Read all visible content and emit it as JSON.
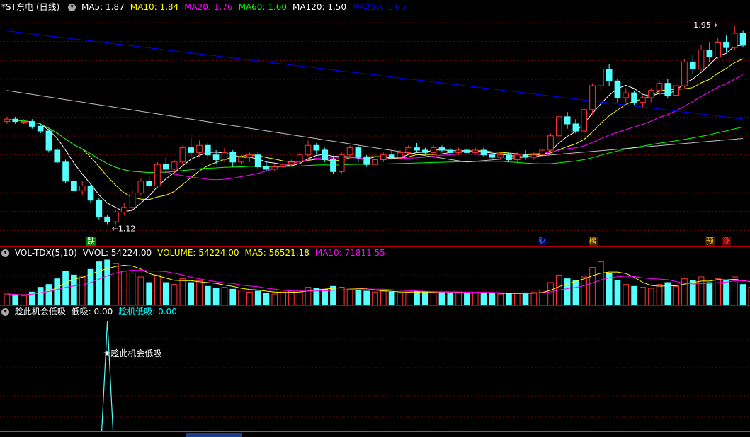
{
  "stock": {
    "name": "*ST东电",
    "period": "(日线)"
  },
  "price_legend": {
    "items": [
      {
        "label": "MA5:",
        "value": "1.87",
        "color": "#ffffff"
      },
      {
        "label": "MA10:",
        "value": "1.84",
        "color": "#ffff00"
      },
      {
        "label": "MA20:",
        "value": "1.76",
        "color": "#ff00ff"
      },
      {
        "label": "MA60:",
        "value": "1.60",
        "color": "#00ff00"
      },
      {
        "label": "MA120:",
        "value": "1.50",
        "color": "#ffffff"
      },
      {
        "label": "MA250:",
        "value": "1.65",
        "color": "#0000ff"
      }
    ]
  },
  "vol_legend": {
    "title": "VOL-TDX(5,10)",
    "items": [
      {
        "label": "VVOL:",
        "value": "54224.00",
        "color": "#ffffff"
      },
      {
        "label": "VOLUME:",
        "value": "54224.00",
        "color": "#ffff00"
      },
      {
        "label": "MA5:",
        "value": "56521.18",
        "color": "#ffff00"
      },
      {
        "label": "MA10:",
        "value": "71811.55",
        "color": "#ff00ff"
      }
    ]
  },
  "ind_legend": {
    "title": "趁此机会低吸",
    "items": [
      {
        "label": "低吸:",
        "value": "0.00",
        "color": "#ffffff"
      },
      {
        "label": "趁机低吸:",
        "value": "0.00",
        "color": "#00ffff"
      }
    ]
  },
  "annotations": {
    "low": "1.12",
    "high": "1.95",
    "signal": "★趁此机会低吸"
  },
  "event_tags": [
    {
      "text": "跌",
      "index": 10,
      "bg": "#008000",
      "color": "#ffffff"
    },
    {
      "text": "财",
      "index": 64,
      "bg": "#000040",
      "color": "#4080ff"
    },
    {
      "text": "榜",
      "index": 70,
      "bg": "#402000",
      "color": "#ffcc00"
    },
    {
      "text": "预",
      "index": 84,
      "bg": "#402000",
      "color": "#ffcc00"
    },
    {
      "text": "涨",
      "index": 86,
      "bg": "#600000",
      "color": "#ff4040"
    }
  ],
  "colors": {
    "up": "#ff3232",
    "down": "#54ffff",
    "grid": "#7a0000",
    "background": "#000000"
  },
  "chart_data": [
    {
      "type": "candlestick",
      "title": "*ST东电 (日线)",
      "ylim": [
        1.05,
        2.0
      ],
      "series_note": "open, close, high, low per daily bar",
      "ohlc": [
        [
          1.55,
          1.56,
          1.57,
          1.54
        ],
        [
          1.56,
          1.55,
          1.57,
          1.54
        ],
        [
          1.55,
          1.55,
          1.56,
          1.54
        ],
        [
          1.55,
          1.53,
          1.56,
          1.52
        ],
        [
          1.53,
          1.51,
          1.54,
          1.5
        ],
        [
          1.51,
          1.43,
          1.52,
          1.42
        ],
        [
          1.43,
          1.38,
          1.44,
          1.37
        ],
        [
          1.38,
          1.3,
          1.39,
          1.29
        ],
        [
          1.3,
          1.26,
          1.31,
          1.25
        ],
        [
          1.26,
          1.28,
          1.3,
          1.24
        ],
        [
          1.28,
          1.22,
          1.29,
          1.21
        ],
        [
          1.22,
          1.15,
          1.23,
          1.14
        ],
        [
          1.15,
          1.13,
          1.16,
          1.12
        ],
        [
          1.13,
          1.17,
          1.18,
          1.12
        ],
        [
          1.17,
          1.19,
          1.21,
          1.16
        ],
        [
          1.19,
          1.25,
          1.26,
          1.18
        ],
        [
          1.25,
          1.3,
          1.31,
          1.24
        ],
        [
          1.3,
          1.28,
          1.32,
          1.27
        ],
        [
          1.28,
          1.37,
          1.38,
          1.27
        ],
        [
          1.37,
          1.35,
          1.4,
          1.33
        ],
        [
          1.35,
          1.38,
          1.39,
          1.33
        ],
        [
          1.38,
          1.44,
          1.45,
          1.36
        ],
        [
          1.44,
          1.42,
          1.48,
          1.4
        ],
        [
          1.42,
          1.45,
          1.47,
          1.4
        ],
        [
          1.45,
          1.41,
          1.46,
          1.39
        ],
        [
          1.41,
          1.39,
          1.43,
          1.37
        ],
        [
          1.39,
          1.42,
          1.44,
          1.38
        ],
        [
          1.42,
          1.38,
          1.43,
          1.36
        ],
        [
          1.38,
          1.4,
          1.41,
          1.37
        ],
        [
          1.4,
          1.41,
          1.42,
          1.38
        ],
        [
          1.41,
          1.36,
          1.42,
          1.35
        ],
        [
          1.36,
          1.35,
          1.38,
          1.34
        ],
        [
          1.35,
          1.36,
          1.37,
          1.34
        ],
        [
          1.36,
          1.37,
          1.38,
          1.35
        ],
        [
          1.37,
          1.38,
          1.39,
          1.36
        ],
        [
          1.38,
          1.41,
          1.42,
          1.37
        ],
        [
          1.41,
          1.45,
          1.47,
          1.4
        ],
        [
          1.45,
          1.43,
          1.46,
          1.41
        ],
        [
          1.43,
          1.39,
          1.44,
          1.38
        ],
        [
          1.39,
          1.34,
          1.4,
          1.33
        ],
        [
          1.34,
          1.41,
          1.42,
          1.33
        ],
        [
          1.41,
          1.44,
          1.45,
          1.4
        ],
        [
          1.44,
          1.4,
          1.45,
          1.38
        ],
        [
          1.4,
          1.37,
          1.41,
          1.36
        ],
        [
          1.37,
          1.39,
          1.4,
          1.36
        ],
        [
          1.39,
          1.41,
          1.42,
          1.38
        ],
        [
          1.41,
          1.4,
          1.43,
          1.39
        ],
        [
          1.4,
          1.42,
          1.43,
          1.39
        ],
        [
          1.42,
          1.44,
          1.45,
          1.41
        ],
        [
          1.44,
          1.43,
          1.46,
          1.42
        ],
        [
          1.43,
          1.42,
          1.44,
          1.41
        ],
        [
          1.42,
          1.44,
          1.45,
          1.41
        ],
        [
          1.44,
          1.43,
          1.45,
          1.42
        ],
        [
          1.43,
          1.42,
          1.44,
          1.41
        ],
        [
          1.42,
          1.43,
          1.44,
          1.41
        ],
        [
          1.43,
          1.42,
          1.44,
          1.41
        ],
        [
          1.42,
          1.43,
          1.44,
          1.41
        ],
        [
          1.43,
          1.41,
          1.44,
          1.4
        ],
        [
          1.41,
          1.4,
          1.42,
          1.39
        ],
        [
          1.4,
          1.41,
          1.42,
          1.39
        ],
        [
          1.41,
          1.39,
          1.42,
          1.38
        ],
        [
          1.39,
          1.41,
          1.42,
          1.38
        ],
        [
          1.41,
          1.4,
          1.43,
          1.39
        ],
        [
          1.4,
          1.41,
          1.42,
          1.39
        ],
        [
          1.41,
          1.43,
          1.44,
          1.4
        ],
        [
          1.43,
          1.49,
          1.5,
          1.42
        ],
        [
          1.49,
          1.57,
          1.58,
          1.48
        ],
        [
          1.57,
          1.54,
          1.59,
          1.52
        ],
        [
          1.54,
          1.51,
          1.56,
          1.5
        ],
        [
          1.51,
          1.6,
          1.61,
          1.5
        ],
        [
          1.6,
          1.7,
          1.71,
          1.58
        ],
        [
          1.7,
          1.77,
          1.78,
          1.68
        ],
        [
          1.77,
          1.72,
          1.79,
          1.7
        ],
        [
          1.72,
          1.65,
          1.73,
          1.63
        ],
        [
          1.65,
          1.67,
          1.69,
          1.63
        ],
        [
          1.67,
          1.63,
          1.68,
          1.62
        ],
        [
          1.63,
          1.65,
          1.66,
          1.61
        ],
        [
          1.65,
          1.68,
          1.69,
          1.63
        ],
        [
          1.68,
          1.71,
          1.72,
          1.66
        ],
        [
          1.71,
          1.66,
          1.73,
          1.65
        ],
        [
          1.66,
          1.7,
          1.72,
          1.65
        ],
        [
          1.7,
          1.8,
          1.81,
          1.69
        ],
        [
          1.8,
          1.77,
          1.83,
          1.75
        ],
        [
          1.77,
          1.85,
          1.87,
          1.76
        ],
        [
          1.85,
          1.82,
          1.88,
          1.8
        ],
        [
          1.82,
          1.88,
          1.9,
          1.81
        ],
        [
          1.88,
          1.86,
          1.91,
          1.84
        ],
        [
          1.86,
          1.92,
          1.95,
          1.85
        ],
        [
          1.92,
          1.87,
          1.93,
          1.86
        ]
      ],
      "moving_averages": [
        {
          "name": "MA5",
          "color": "#ffffff",
          "period": 5
        },
        {
          "name": "MA10",
          "color": "#ffff00",
          "period": 10
        },
        {
          "name": "MA20",
          "color": "#ff00ff",
          "period": 20
        },
        {
          "name": "MA60",
          "color": "#00ff00",
          "period": 60
        },
        {
          "name": "MA120",
          "color": "#ffffff",
          "period": 120
        },
        {
          "name": "MA250",
          "color": "#0000ff",
          "period": 250
        }
      ]
    },
    {
      "type": "bar",
      "title": "VOL-TDX(5,10)",
      "ylim": [
        0,
        260000
      ],
      "values": [
        60,
        55,
        50,
        70,
        95,
        110,
        140,
        180,
        160,
        150,
        190,
        230,
        240,
        220,
        180,
        170,
        150,
        120,
        160,
        120,
        110,
        140,
        120,
        130,
        100,
        90,
        95,
        85,
        80,
        70,
        75,
        65,
        60,
        70,
        75,
        80,
        95,
        90,
        85,
        100,
        95,
        85,
        80,
        75,
        70,
        75,
        70,
        65,
        70,
        75,
        72,
        70,
        68,
        66,
        70,
        68,
        66,
        64,
        62,
        60,
        62,
        64,
        66,
        68,
        80,
        120,
        160,
        140,
        130,
        150,
        200,
        230,
        170,
        130,
        110,
        100,
        95,
        90,
        110,
        120,
        100,
        140,
        130,
        150,
        120,
        140,
        130,
        150,
        110,
        95
      ]
    },
    {
      "type": "line",
      "title": "趁此机会低吸",
      "ylim": [
        0,
        1
      ],
      "x_signal_index": 12,
      "values_note": "single spike to 1 at signal bar, zero elsewhere"
    }
  ]
}
